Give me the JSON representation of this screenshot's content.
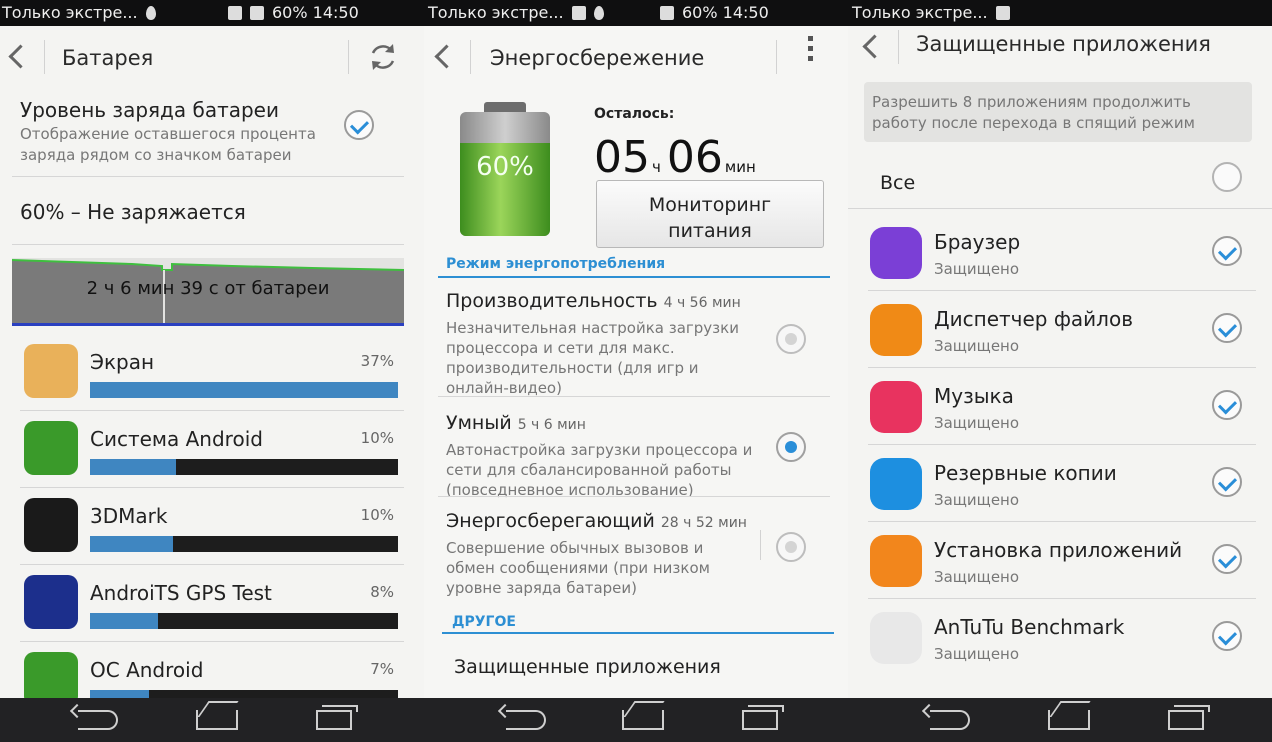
{
  "status_bar": {
    "segments": [
      {
        "text": "Только экстре...",
        "right": ""
      },
      {
        "text": "Только экстре...",
        "right": "60% 14:50"
      },
      {
        "text": "Только экстре...",
        "right": ""
      }
    ],
    "left_right": "60% 14:50"
  },
  "battery_panel": {
    "title": "Батарея",
    "indicator_title": "Уровень заряда батареи",
    "indicator_desc": "Отображение оставшегося процента заряда рядом со значком батареи",
    "indicator_checked": true,
    "state": "60% – Не заряжается",
    "graph_label": "2 ч 6 мин 39 с от батареи",
    "apps": [
      {
        "name": "Экран",
        "percent": "37%",
        "fill": 1.0,
        "icon": "screen-icon",
        "color": "#e9b15a"
      },
      {
        "name": "Система Android",
        "percent": "10%",
        "fill": 0.28,
        "icon": "android-system-icon",
        "color": "#3a9a2a"
      },
      {
        "name": "3DMark",
        "percent": "10%",
        "fill": 0.27,
        "icon": "3dmark-icon",
        "color": "#1a1a1a"
      },
      {
        "name": "AndroiTS GPS Test",
        "percent": "8%",
        "fill": 0.22,
        "icon": "gps-test-icon",
        "color": "#1c2f8c"
      },
      {
        "name": "ОС Android",
        "percent": "7%",
        "fill": 0.19,
        "icon": "android-os-icon",
        "color": "#3a9a2a"
      }
    ]
  },
  "energy_panel": {
    "title": "Энергосбережение",
    "battery_percent": "60%",
    "remaining_label": "Осталось:",
    "remaining_hours": "05",
    "hours_unit": "ч",
    "remaining_minutes": "06",
    "minutes_unit": "мин",
    "monitor_button_line1": "Мониторинг",
    "monitor_button_line2": "питания",
    "section_mode": "Режим энергопотребления",
    "modes": [
      {
        "title": "Производительность",
        "time": "4 ч 56 мин",
        "desc": "Незначительная настройка загрузки процессора и сети для макс. производительности (для игр и онлайн-видео)",
        "selected": false
      },
      {
        "title": "Умный",
        "time": "5 ч 6 мин",
        "desc": "Автонастройка загрузки процессора и сети для сбалансированной работы (повседневное использование)",
        "selected": true
      },
      {
        "title": "Энергосберегающий",
        "time": "28 ч 52 мин",
        "desc": "Совершение обычных вызовов и обмен сообщениями (при низком уровне заряда батареи)",
        "selected": false
      }
    ],
    "section_other": "ДРУГОЕ",
    "protected_apps_link": "Защищенные приложения"
  },
  "protected_panel": {
    "title": "Защищенные приложения",
    "info": "Разрешить 8 приложениям продолжить работу после перехода в спящий режим",
    "all_label": "Все",
    "all_checked": false,
    "apps": [
      {
        "name": "Браузер",
        "status": "Защищено",
        "icon": "browser-icon",
        "color": "#7b3fd6"
      },
      {
        "name": "Диспетчер файлов",
        "status": "Защищено",
        "icon": "file-manager-icon",
        "color": "#f08a16"
      },
      {
        "name": "Музыка",
        "status": "Защищено",
        "icon": "music-icon",
        "color": "#e8335f"
      },
      {
        "name": "Резервные копии",
        "status": "Защищено",
        "icon": "backup-icon",
        "color": "#1d8fe0"
      },
      {
        "name": "Установка приложений",
        "status": "Защищено",
        "icon": "installer-icon",
        "color": "#f2861c"
      },
      {
        "name": "AnTuTu Benchmark",
        "status": "Защищено",
        "icon": "antutu-icon",
        "color": "#e8e8e8"
      }
    ]
  }
}
